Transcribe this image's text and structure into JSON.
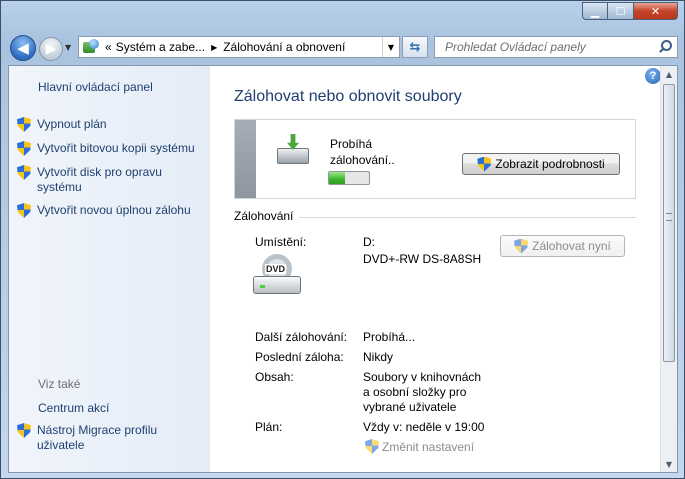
{
  "window": {
    "controls": {
      "minimize": "▁",
      "maximize": "☐",
      "close": "✕"
    }
  },
  "address_bar": {
    "prefix": "«",
    "segments": [
      "Systém a zabe...",
      "Zálohování a obnovení"
    ],
    "separator": "▶"
  },
  "search": {
    "placeholder": "Prohledat Ovládací panely"
  },
  "sidebar": {
    "home_link": "Hlavní ovládací panel",
    "tasks": [
      "Vypnout plán",
      "Vytvořit bitovou kopii systému",
      "Vytvořit disk pro opravu systému",
      "Vytvořit novou úplnou zálohu"
    ],
    "see_also_title": "Viz také",
    "see_also_links": [
      "Centrum akcí",
      "Nástroj Migrace profilu uživatele"
    ]
  },
  "main": {
    "heading": "Zálohovat nebo obnovit soubory",
    "status": {
      "line1": "Probíhá",
      "line2": "zálohování..",
      "progress_fraction": 0.4,
      "details_button": "Zobrazit podrobnosti"
    },
    "backup_section": {
      "title": "Zálohování",
      "location_label": "Umístění:",
      "location_drive": "D:",
      "location_device": "DVD+-RW DS-8A8SH",
      "backup_now_button": "Zálohovat nyní",
      "dvd_label": "DVD",
      "next_label": "Další zálohování:",
      "next_value": "Probíhá...",
      "last_label": "Poslední záloha:",
      "last_value": "Nikdy",
      "contents_label": "Obsah:",
      "contents_value": [
        "Soubory v knihovnách",
        "a osobní složky pro",
        "vybrané uživatele"
      ],
      "schedule_label": "Plán:",
      "schedule_value": "Vždy v: neděle v 19:00",
      "change_settings_link": "Změnit nastavení"
    },
    "help_icon": "?"
  },
  "colors": {
    "link": "#1e3f6f",
    "progress": "#3cb52b"
  }
}
